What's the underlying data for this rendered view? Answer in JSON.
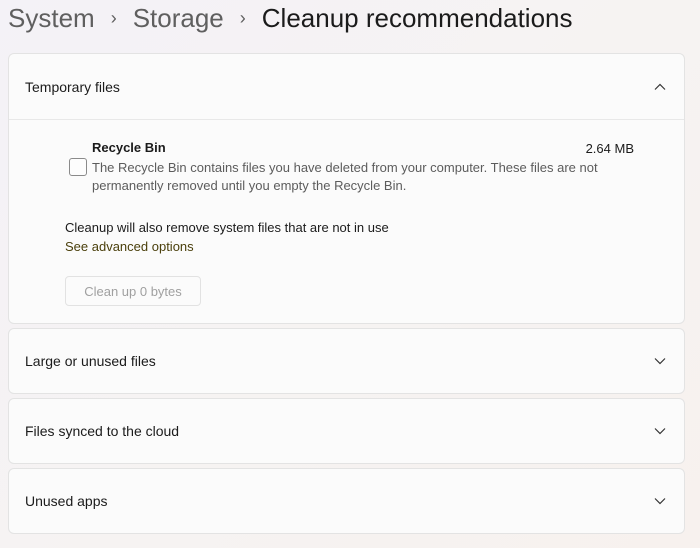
{
  "breadcrumb": {
    "items": [
      "System",
      "Storage"
    ],
    "current": "Cleanup recommendations",
    "separator": "›"
  },
  "sections": [
    {
      "title": "Temporary files",
      "expanded": true,
      "items": [
        {
          "name": "Recycle Bin",
          "size": "2.64 MB",
          "checked": false,
          "description": "The Recycle Bin contains files you have deleted from your computer. These files are not permanently removed until you empty the Recycle Bin."
        }
      ],
      "note": "Cleanup will also remove system files that are not in use",
      "link": "See advanced options",
      "button": "Clean up 0 bytes"
    },
    {
      "title": "Large or unused files",
      "expanded": false
    },
    {
      "title": "Files synced to the cloud",
      "expanded": false
    },
    {
      "title": "Unused apps",
      "expanded": false
    }
  ],
  "icons": {
    "collapse": "chevron-up-icon",
    "expand": "chevron-down-icon"
  },
  "colors": {
    "link": "#4a3f0b",
    "disabled_text": "#a0a0a0"
  }
}
